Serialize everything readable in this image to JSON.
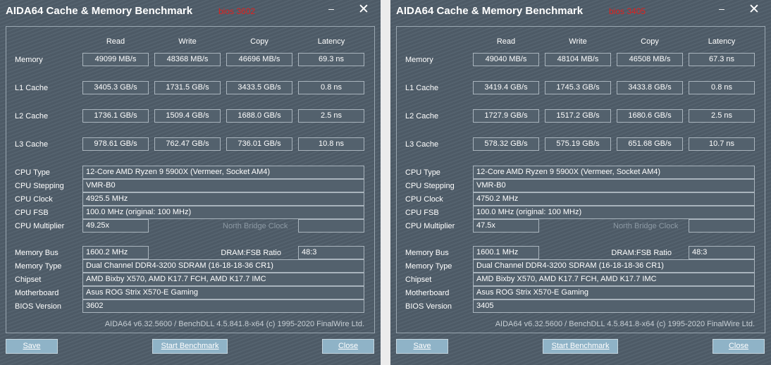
{
  "windows": [
    {
      "title": "AIDA64 Cache & Memory Benchmark",
      "note": "bios 3602",
      "minimize_glyph": "–",
      "close_glyph": "✕",
      "columns": [
        "Read",
        "Write",
        "Copy",
        "Latency"
      ],
      "rows": [
        {
          "label": "Memory",
          "values": [
            "49099 MB/s",
            "48368 MB/s",
            "46696 MB/s",
            "69.3 ns"
          ]
        },
        {
          "label": "L1 Cache",
          "values": [
            "3405.3 GB/s",
            "1731.5 GB/s",
            "3433.5 GB/s",
            "0.8 ns"
          ]
        },
        {
          "label": "L2 Cache",
          "values": [
            "1736.1 GB/s",
            "1509.4 GB/s",
            "1688.0 GB/s",
            "2.5 ns"
          ]
        },
        {
          "label": "L3 Cache",
          "values": [
            "978.61 GB/s",
            "762.47 GB/s",
            "736.01 GB/s",
            "10.8 ns"
          ]
        }
      ],
      "cpu_type": {
        "label": "CPU Type",
        "value": "12-Core AMD Ryzen 9 5900X  (Vermeer, Socket AM4)"
      },
      "cpu_stepping": {
        "label": "CPU Stepping",
        "value": "VMR-B0"
      },
      "cpu_clock": {
        "label": "CPU Clock",
        "value": "4925.5 MHz"
      },
      "cpu_fsb": {
        "label": "CPU FSB",
        "value": "100.0 MHz  (original: 100 MHz)"
      },
      "cpu_multiplier": {
        "label": "CPU Multiplier",
        "value": "49.25x"
      },
      "north_bridge_clock": {
        "label": "North Bridge Clock",
        "value": ""
      },
      "memory_bus": {
        "label": "Memory Bus",
        "value": "1600.2 MHz"
      },
      "dram_fsb": {
        "label": "DRAM:FSB Ratio",
        "value": "48:3"
      },
      "memory_type": {
        "label": "Memory Type",
        "value": "Dual Channel DDR4-3200 SDRAM  (16-18-18-36 CR1)"
      },
      "chipset": {
        "label": "Chipset",
        "value": "AMD Bixby X570, AMD K17.7 FCH, AMD K17.7 IMC"
      },
      "motherboard": {
        "label": "Motherboard",
        "value": "Asus ROG Strix X570-E Gaming"
      },
      "bios_version": {
        "label": "BIOS Version",
        "value": "3602"
      },
      "footer": "AIDA64 v6.32.5600 / BenchDLL 4.5.841.8-x64  (c) 1995-2020 FinalWire Ltd.",
      "buttons": {
        "save": "Save",
        "start": "Start Benchmark",
        "close": "Close"
      }
    },
    {
      "title": "AIDA64 Cache & Memory Benchmark",
      "note": "bios 3405",
      "minimize_glyph": "–",
      "close_glyph": "✕",
      "columns": [
        "Read",
        "Write",
        "Copy",
        "Latency"
      ],
      "rows": [
        {
          "label": "Memory",
          "values": [
            "49040 MB/s",
            "48104 MB/s",
            "46508 MB/s",
            "67.3 ns"
          ]
        },
        {
          "label": "L1 Cache",
          "values": [
            "3419.4 GB/s",
            "1745.3 GB/s",
            "3433.8 GB/s",
            "0.8 ns"
          ]
        },
        {
          "label": "L2 Cache",
          "values": [
            "1727.9 GB/s",
            "1517.2 GB/s",
            "1680.6 GB/s",
            "2.5 ns"
          ]
        },
        {
          "label": "L3 Cache",
          "values": [
            "578.32 GB/s",
            "575.19 GB/s",
            "651.68 GB/s",
            "10.7 ns"
          ]
        }
      ],
      "cpu_type": {
        "label": "CPU Type",
        "value": "12-Core AMD Ryzen 9 5900X  (Vermeer, Socket AM4)"
      },
      "cpu_stepping": {
        "label": "CPU Stepping",
        "value": "VMR-B0"
      },
      "cpu_clock": {
        "label": "CPU Clock",
        "value": "4750.2 MHz"
      },
      "cpu_fsb": {
        "label": "CPU FSB",
        "value": "100.0 MHz  (original: 100 MHz)"
      },
      "cpu_multiplier": {
        "label": "CPU Multiplier",
        "value": "47.5x"
      },
      "north_bridge_clock": {
        "label": "North Bridge Clock",
        "value": ""
      },
      "memory_bus": {
        "label": "Memory Bus",
        "value": "1600.1 MHz"
      },
      "dram_fsb": {
        "label": "DRAM:FSB Ratio",
        "value": "48:3"
      },
      "memory_type": {
        "label": "Memory Type",
        "value": "Dual Channel DDR4-3200 SDRAM  (16-18-18-36 CR1)"
      },
      "chipset": {
        "label": "Chipset",
        "value": "AMD Bixby X570, AMD K17.7 FCH, AMD K17.7 IMC"
      },
      "motherboard": {
        "label": "Motherboard",
        "value": "Asus ROG Strix X570-E Gaming"
      },
      "bios_version": {
        "label": "BIOS Version",
        "value": "3405"
      },
      "footer": "AIDA64 v6.32.5600 / BenchDLL 4.5.841.8-x64  (c) 1995-2020 FinalWire Ltd.",
      "buttons": {
        "save": "Save",
        "start": "Start Benchmark",
        "close": "Close"
      }
    }
  ]
}
